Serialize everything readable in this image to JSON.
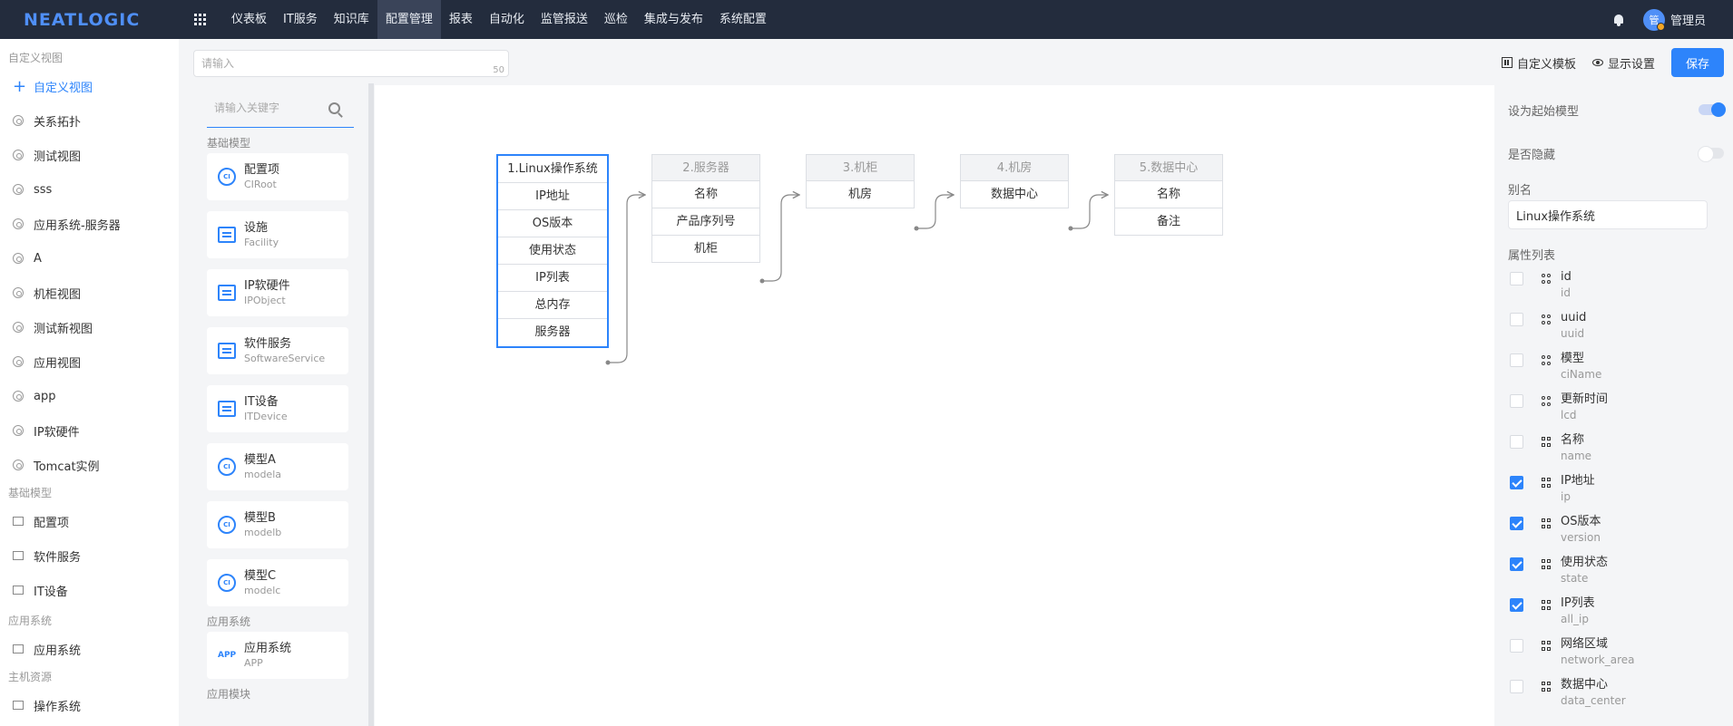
{
  "app": {
    "logo": "NEATLOGIC"
  },
  "nav": {
    "items": [
      "仪表板",
      "IT服务",
      "知识库",
      "配置管理",
      "报表",
      "自动化",
      "监管报送",
      "巡检",
      "集成与发布",
      "系统配置"
    ],
    "active": "配置管理"
  },
  "user": {
    "avatar_char": "管",
    "name": "管理员"
  },
  "sidebar": {
    "group1_title": "自定义视图",
    "add_label": "自定义视图",
    "views": [
      "关系拓扑",
      "测试视图",
      "sss",
      "应用系统-服务器",
      "A",
      "机柜视图",
      "测试新视图",
      "应用视图",
      "app",
      "IP软硬件",
      "Tomcat实例"
    ],
    "group2_title": "基础模型",
    "base_items": [
      "配置项",
      "软件服务",
      "IT设备"
    ],
    "group3_title": "应用系统",
    "app_items": [
      "应用系统"
    ],
    "group4_title": "主机资源",
    "host_items": [
      "操作系统"
    ]
  },
  "title_input": {
    "placeholder": "请输入",
    "counter": "50"
  },
  "model_panel": {
    "search_placeholder": "请输入关键字",
    "group_base": "基础模型",
    "base_models": [
      {
        "name": "配置项",
        "code": "CIRoot",
        "icon": "ci-icon"
      },
      {
        "name": "设施",
        "code": "Facility",
        "icon": "server-icon"
      },
      {
        "name": "IP软硬件",
        "code": "IPObject",
        "icon": "device-gear-icon"
      },
      {
        "name": "软件服务",
        "code": "SoftwareService",
        "icon": "folder-gear-icon"
      },
      {
        "name": "IT设备",
        "code": "ITDevice",
        "icon": "device-gear-icon"
      },
      {
        "name": "模型A",
        "code": "modela",
        "icon": "ci-icon"
      },
      {
        "name": "模型B",
        "code": "modelb",
        "icon": "ci-icon"
      },
      {
        "name": "模型C",
        "code": "modelc",
        "icon": "ci-icon"
      }
    ],
    "group_app": "应用系统",
    "app_models": [
      {
        "name": "应用系统",
        "code": "APP",
        "icon": "app-icon"
      }
    ],
    "group_module": "应用模块",
    "ci_glyph": "CI",
    "app_glyph": "APP"
  },
  "toolbar": {
    "template_label": "自定义模板",
    "display_label": "显示设置",
    "save_label": "保存"
  },
  "canvas": {
    "nodes": [
      {
        "title": "1.Linux操作系统",
        "rows": [
          "IP地址",
          "OS版本",
          "使用状态",
          "IP列表",
          "总内存",
          "服务器"
        ],
        "selected": true
      },
      {
        "title": "2.服务器",
        "rows": [
          "名称",
          "产品序列号",
          "机柜"
        ],
        "selected": false
      },
      {
        "title": "3.机柜",
        "rows": [
          "机房"
        ],
        "selected": false
      },
      {
        "title": "4.机房",
        "rows": [
          "数据中心"
        ],
        "selected": false
      },
      {
        "title": "5.数据中心",
        "rows": [
          "名称",
          "备注"
        ],
        "selected": false
      }
    ]
  },
  "right_panel": {
    "start_model_label": "设为起始模型",
    "start_model_on": true,
    "hidden_label": "是否隐藏",
    "hidden_on": false,
    "alias_label": "别名",
    "alias_value": "Linux操作系统",
    "attr_list_label": "属性列表",
    "attributes": [
      {
        "name": "id",
        "code": "id",
        "checked": false,
        "icon": "link-icon"
      },
      {
        "name": "uuid",
        "code": "uuid",
        "checked": false,
        "icon": "link-icon"
      },
      {
        "name": "模型",
        "code": "ciName",
        "checked": false,
        "icon": "link-icon"
      },
      {
        "name": "更新时间",
        "code": "lcd",
        "checked": false,
        "icon": "link-icon"
      },
      {
        "name": "名称",
        "code": "name",
        "checked": false,
        "icon": "grid-icon"
      },
      {
        "name": "IP地址",
        "code": "ip",
        "checked": true,
        "icon": "grid-icon"
      },
      {
        "name": "OS版本",
        "code": "version",
        "checked": true,
        "icon": "grid-icon"
      },
      {
        "name": "使用状态",
        "code": "state",
        "checked": true,
        "icon": "grid-icon"
      },
      {
        "name": "IP列表",
        "code": "all_ip",
        "checked": true,
        "icon": "grid-icon"
      },
      {
        "name": "网络区域",
        "code": "network_area",
        "checked": false,
        "icon": "grid-icon"
      },
      {
        "name": "数据中心",
        "code": "data_center",
        "checked": false,
        "icon": "grid-icon"
      }
    ]
  },
  "colors": {
    "accent": "#2d84fb",
    "topbar": "#232c3d",
    "logo": "#4f8ff7"
  }
}
